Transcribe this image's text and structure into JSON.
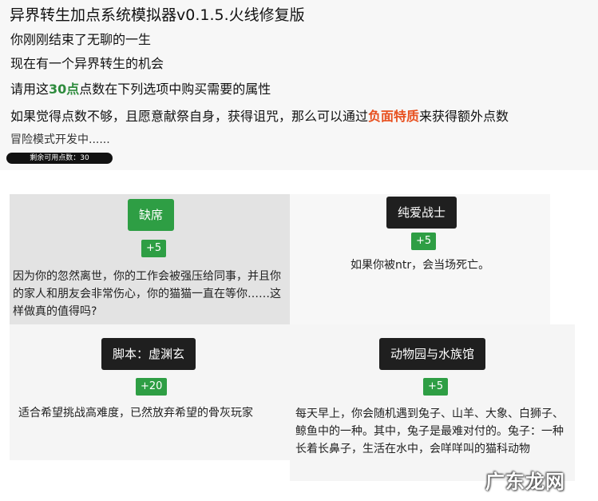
{
  "header": {
    "title": "异界转生加点系统模拟器v0.1.5.火线修复版",
    "line1": "你刚刚结束了无聊的一生",
    "line2": "现在有一个异界转生的机会",
    "line3_prefix": "请用这",
    "line3_points": "30点",
    "line3_suffix": "点数在下列选项中购买需要的属性",
    "line4_prefix": "如果觉得点数不够，且愿意献祭自身，获得诅咒，那么可以通过",
    "line4_link": "负面特质",
    "line4_suffix": "来获得额外点数",
    "line5": "冒险模式开发中......",
    "remaining_points": "剩余可用点数：30"
  },
  "options": [
    {
      "name": "缺席",
      "cost": "+5",
      "description": "因为你的忽然离世，你的工作会被强压给同事，并且你的家人和朋友会非常伤心，你的猫猫一直在等你……这样做真的值得吗?"
    },
    {
      "name": "纯爱战士",
      "cost": "+5",
      "description": "如果你被ntr，会当场死亡。"
    },
    {
      "name": "脚本：虚渊玄",
      "cost": "+20",
      "description": "适合希望挑战高难度，已然放弃希望的骨灰玩家"
    },
    {
      "name": "动物园与水族馆",
      "cost": "+5",
      "description": "每天早上，你会随机遇到兔子、山羊、大象、白狮子、鲸鱼中的一种。其中，兔子是最难对付的。兔子：一种长着长鼻子，生活在水中，会咩咩叫的猫科动物"
    }
  ],
  "watermark": "广东龙网",
  "colors": {
    "accent_green": "#2e9e44",
    "highlight_orange": "#e8501f",
    "dark_button": "#1f1f1f"
  }
}
